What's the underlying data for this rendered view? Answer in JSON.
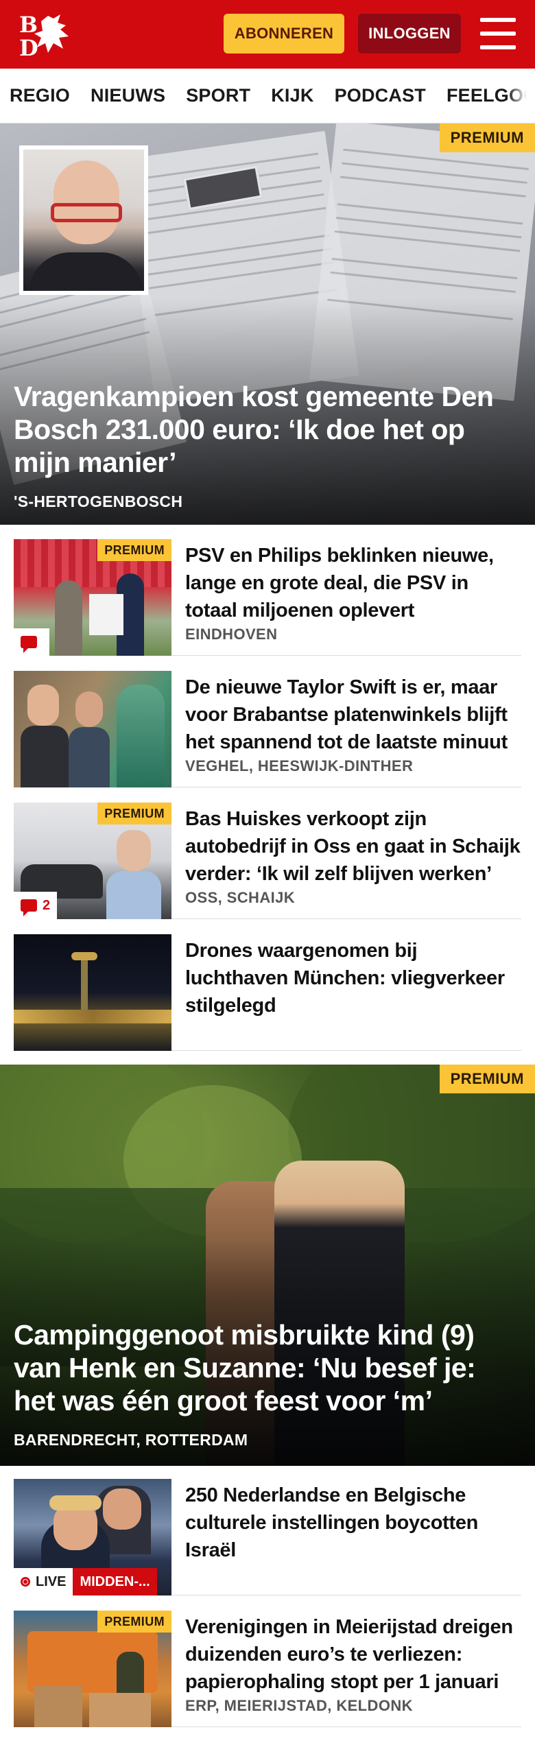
{
  "header": {
    "logo_text": "BD",
    "subscribe_label": "ABONNEREN",
    "login_label": "INLOGGEN",
    "menu_icon": "hamburger-menu-icon",
    "brand_color": "#d10a10",
    "accent_color": "#fbc437"
  },
  "nav": {
    "items": [
      "REGIO",
      "NIEUWS",
      "SPORT",
      "KIJK",
      "PODCAST",
      "FEELGOOD"
    ]
  },
  "hero1": {
    "premium_label": "PREMIUM",
    "headline": "Vragenkampioen kost gemeente Den Bosch 231.000 euro: ‘Ik doe het op mijn manier’",
    "location": "'S-HERTOGENBOSCH"
  },
  "stories": [
    {
      "premium_label": "PREMIUM",
      "title": "PSV en Philips beklinken nieuwe, lange en grote deal, die PSV in totaal miljoenen oplevert",
      "location": "EINDHOVEN",
      "comments": ""
    },
    {
      "title": "De nieuwe Taylor Swift is er, maar voor Brabantse platenwin­kels blijft het spannend tot de laatste minuut",
      "location": "VEGHEL, HEESWIJK-DINTHER"
    },
    {
      "premium_label": "PREMIUM",
      "title": "Bas Huiskes verkoopt zijn autobedrijf in Oss en gaat in Schaijk verder: ‘Ik wil zelf blijven werken’",
      "location": "OSS, SCHAIJK",
      "comments": "2"
    },
    {
      "title": "Drones waargenomen bij luchthaven München: vliegver­keer stilgelegd",
      "location": ""
    }
  ],
  "hero2": {
    "premium_label": "PREMIUM",
    "headline": "Campinggenoot misbruikte kind (9) van Henk en Suzanne: ‘Nu besef je: het was één groot feest voor ‘m’",
    "location": "BARENDRECHT, ROTTERDAM"
  },
  "stories2": [
    {
      "title": "250 Nederlandse en Belgische culturele instellingen boycotten Israël",
      "location": "",
      "live_label": "LIVE",
      "live_tag": "MIDDEN-..."
    },
    {
      "premium_label": "PREMIUM",
      "title": "Verenigingen in Meierijstad dreigen duizenden euro’s te verliezen: papierophaling stopt per 1 januari",
      "location": "ERP, MEIERIJSTAD, KELDONK"
    }
  ]
}
